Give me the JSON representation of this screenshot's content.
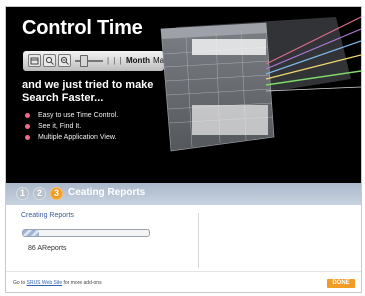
{
  "banner": {
    "title": "Control Time",
    "toolbar": {
      "icons": [
        "calendar-icon",
        "zoom-in-icon",
        "zoom-out-icon"
      ],
      "slider_ticks": "| | |",
      "month_label": "Month",
      "next_month_label": "March"
    },
    "headline": "and we just tried to make Search Faster...",
    "bullets": [
      "Easy to use Time Control.",
      "See it, Find It.",
      "Multiple Application View."
    ],
    "colors": {
      "bullet": "#f06a8e",
      "background": "#000000"
    }
  },
  "steps": {
    "items": [
      {
        "number": "1",
        "state": "inactive"
      },
      {
        "number": "2",
        "state": "inactive"
      },
      {
        "number": "3",
        "state": "active"
      }
    ],
    "title": "Ceating Reports",
    "colors": {
      "active": "#f39c23",
      "bar": "#b6c3d4"
    }
  },
  "main": {
    "section_title": "Creating Reports",
    "progress": 0.13,
    "report_count": "86 AReports"
  },
  "footer": {
    "text_prefix": "Go to",
    "link_text": "SRUS Web Site",
    "text_suffix": "for more add-ons",
    "done_label": "DONE"
  }
}
